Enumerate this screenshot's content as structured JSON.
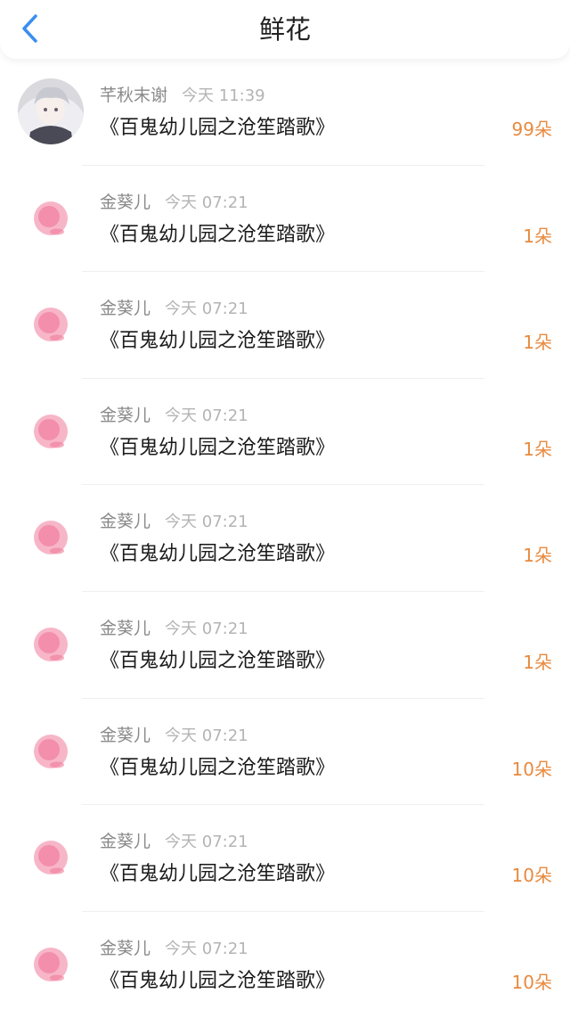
{
  "header": {
    "title": "鲜花"
  },
  "items": [
    {
      "name": "芊秋末谢",
      "time": "今天 11:39",
      "book": "《百鬼幼儿园之沧笙踏歌》",
      "count": "99朵"
    },
    {
      "name": "金葵儿",
      "time": "今天 07:21",
      "book": "《百鬼幼儿园之沧笙踏歌》",
      "count": "1朵"
    },
    {
      "name": "金葵儿",
      "time": "今天 07:21",
      "book": "《百鬼幼儿园之沧笙踏歌》",
      "count": "1朵"
    },
    {
      "name": "金葵儿",
      "time": "今天 07:21",
      "book": "《百鬼幼儿园之沧笙踏歌》",
      "count": "1朵"
    },
    {
      "name": "金葵儿",
      "time": "今天 07:21",
      "book": "《百鬼幼儿园之沧笙踏歌》",
      "count": "1朵"
    },
    {
      "name": "金葵儿",
      "time": "今天 07:21",
      "book": "《百鬼幼儿园之沧笙踏歌》",
      "count": "1朵"
    },
    {
      "name": "金葵儿",
      "time": "今天 07:21",
      "book": "《百鬼幼儿园之沧笙踏歌》",
      "count": "10朵"
    },
    {
      "name": "金葵儿",
      "time": "今天 07:21",
      "book": "《百鬼幼儿园之沧笙踏歌》",
      "count": "10朵"
    },
    {
      "name": "金葵儿",
      "time": "今天 07:21",
      "book": "《百鬼幼儿园之沧笙踏歌》",
      "count": "10朵"
    }
  ],
  "colors": {
    "accent": "#e88a3f",
    "back": "#3b8ef0",
    "flower": "#f07a9a"
  }
}
